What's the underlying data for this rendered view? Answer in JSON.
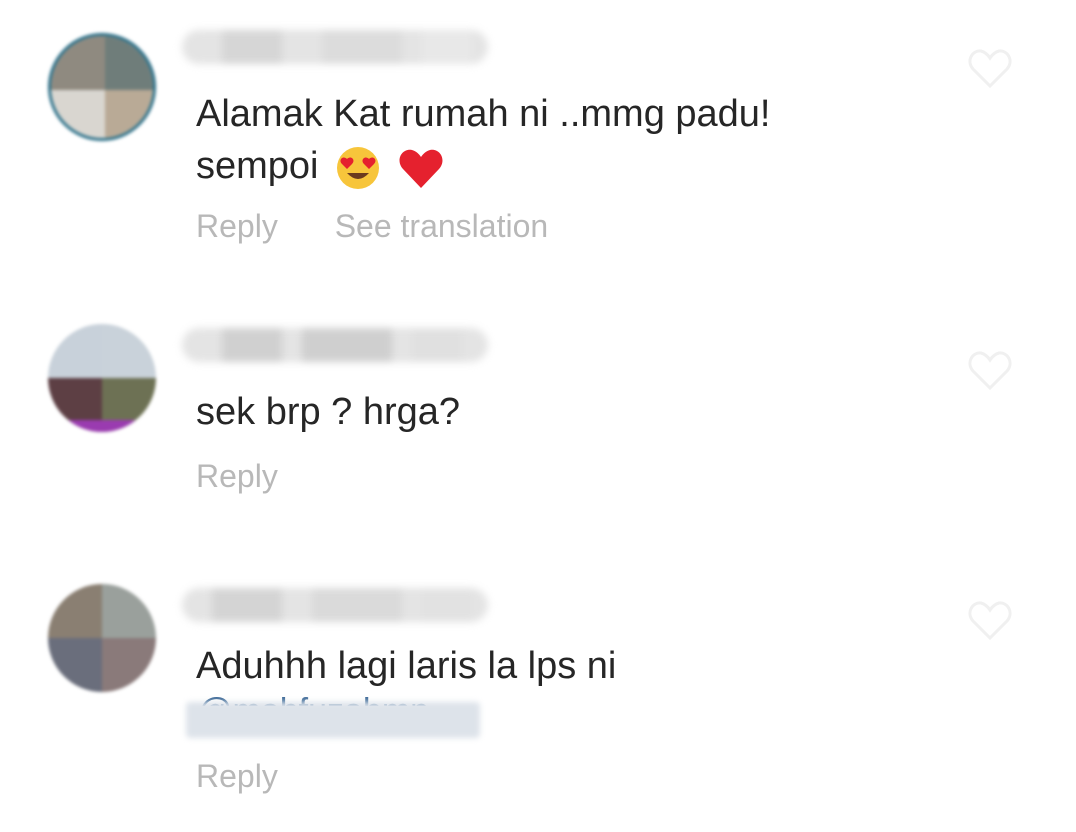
{
  "comments": [
    {
      "line1": "Alamak Kat rumah ni ..mmg padu!",
      "line2": "sempoi",
      "emojis": [
        "smiling-face-with-heart-eyes-icon",
        "red-heart-icon"
      ],
      "actions": [
        "Reply",
        "See translation"
      ]
    },
    {
      "line1": "sek brp ? hrga?",
      "actions": [
        "Reply"
      ]
    },
    {
      "line1": "Aduhhh lagi laris la lps ni",
      "mention": "@mahfuzahmn",
      "actions": [
        "Reply"
      ]
    }
  ],
  "colors": {
    "text": "#262626",
    "action": "#b8b8b8",
    "heart_outline": "#f0f0f0",
    "mention": "#3f6b99",
    "heart_emoji": "#e5212e",
    "emoji_face": "#f7c53b"
  }
}
